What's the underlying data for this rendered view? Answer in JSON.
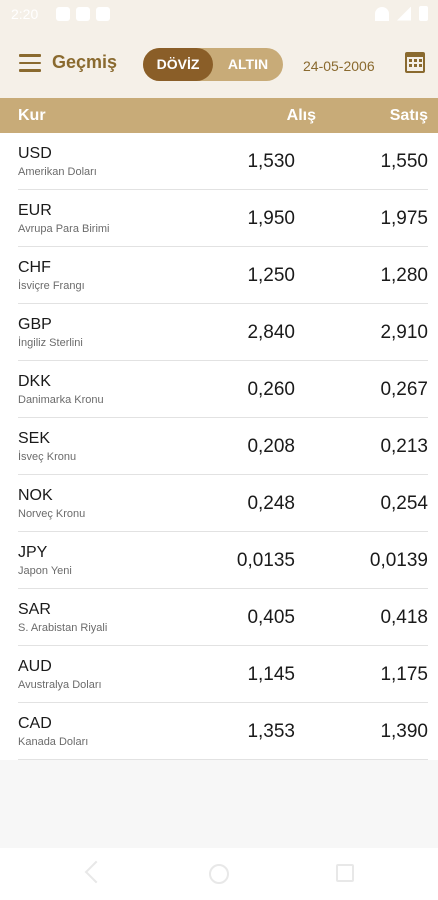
{
  "status": {
    "time": "2:20"
  },
  "appbar": {
    "title": "Geçmiş",
    "tabs": {
      "doviz": "DÖVİZ",
      "altin": "ALTIN",
      "selected": "DÖVİZ"
    },
    "date": "24-05-2006"
  },
  "table": {
    "headers": {
      "kur": "Kur",
      "alis": "Alış",
      "satis": "Satış"
    },
    "rows": [
      {
        "code": "USD",
        "name": "Amerikan Doları",
        "buy": "1,530",
        "sell": "1,550"
      },
      {
        "code": "EUR",
        "name": "Avrupa Para Birimi",
        "buy": "1,950",
        "sell": "1,975"
      },
      {
        "code": "CHF",
        "name": "İsviçre Frangı",
        "buy": "1,250",
        "sell": "1,280"
      },
      {
        "code": "GBP",
        "name": "İngiliz Sterlini",
        "buy": "2,840",
        "sell": "2,910"
      },
      {
        "code": "DKK",
        "name": "Danimarka Kronu",
        "buy": "0,260",
        "sell": "0,267"
      },
      {
        "code": "SEK",
        "name": "İsveç Kronu",
        "buy": "0,208",
        "sell": "0,213"
      },
      {
        "code": "NOK",
        "name": "Norveç Kronu",
        "buy": "0,248",
        "sell": "0,254"
      },
      {
        "code": "JPY",
        "name": "Japon Yeni",
        "buy": "0,0135",
        "sell": "0,0139"
      },
      {
        "code": "SAR",
        "name": "S. Arabistan Riyali",
        "buy": "0,405",
        "sell": "0,418"
      },
      {
        "code": "AUD",
        "name": "Avustralya Doları",
        "buy": "1,145",
        "sell": "1,175"
      },
      {
        "code": "CAD",
        "name": "Kanada Doları",
        "buy": "1,353",
        "sell": "1,390"
      }
    ]
  },
  "icons": {
    "menu": "menu-icon",
    "calendar": "calendar-icon",
    "nav_back": "back-icon",
    "nav_home": "home-icon",
    "nav_recents": "recents-icon"
  },
  "colors": {
    "accent": "#8a6a2f",
    "selected_tab": "#8a5e28",
    "header_bar": "#c8ab78",
    "appbar_bg": "#f5f0e8"
  }
}
